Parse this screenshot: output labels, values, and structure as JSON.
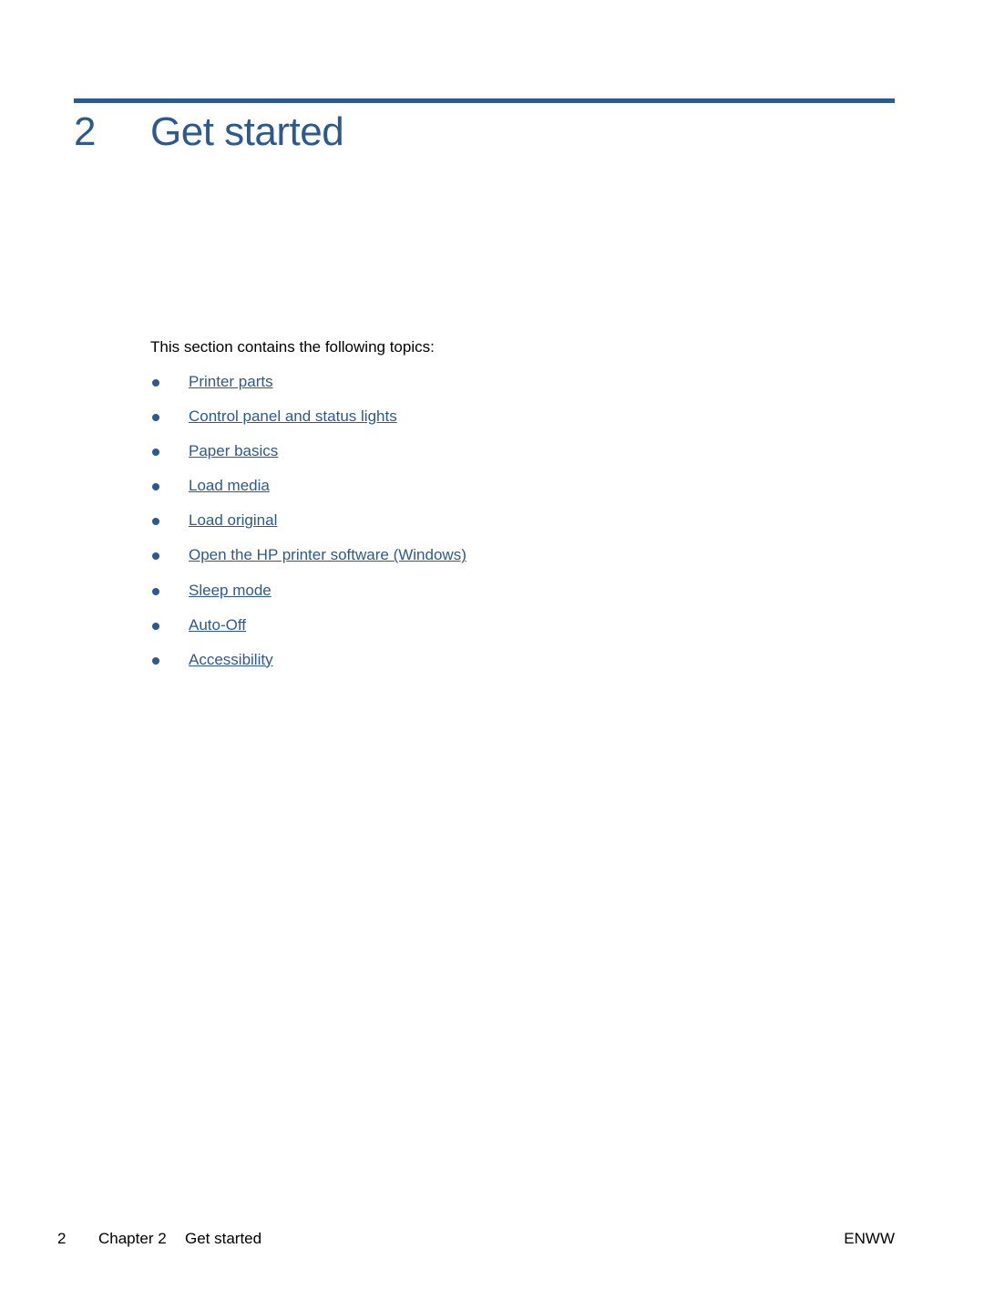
{
  "chapter": {
    "number": "2",
    "title": "Get started"
  },
  "intro": "This section contains the following topics:",
  "topics": [
    {
      "label": "Printer parts"
    },
    {
      "label": "Control panel and status lights"
    },
    {
      "label": "Paper basics"
    },
    {
      "label": "Load media"
    },
    {
      "label": "Load original"
    },
    {
      "label": "Open the HP printer software (Windows)"
    },
    {
      "label": "Sleep mode"
    },
    {
      "label": "Auto-Off"
    },
    {
      "label": "Accessibility"
    }
  ],
  "footer": {
    "page_number": "2",
    "chapter_label": "Chapter 2",
    "chapter_title": "Get started",
    "locale": "ENWW"
  },
  "colors": {
    "accent": "#2c5a8f"
  }
}
